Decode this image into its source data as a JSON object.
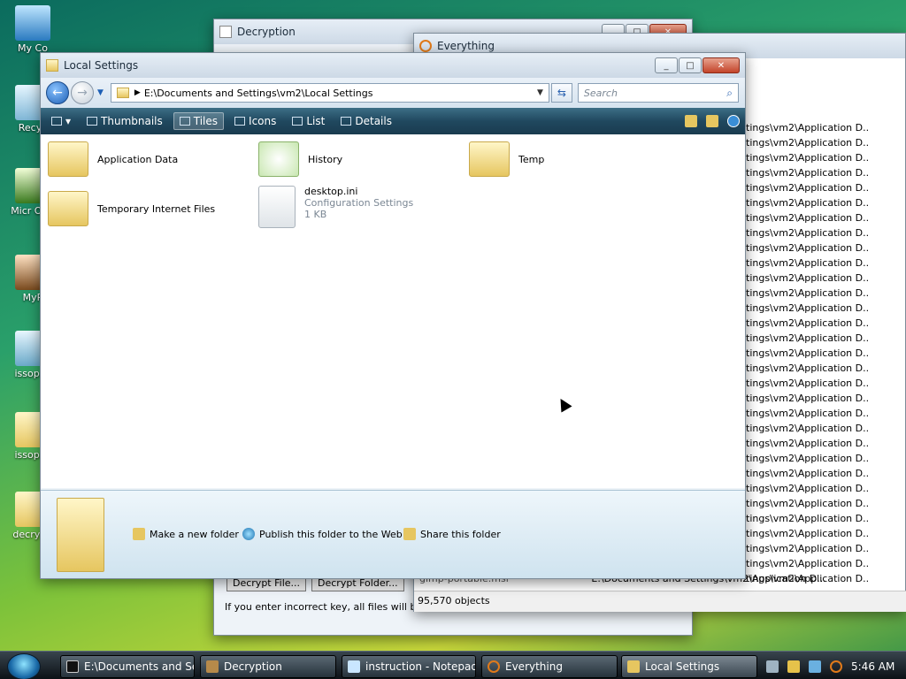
{
  "desktop": {
    "icons": [
      {
        "label": "My Co"
      },
      {
        "label": "Recyc"
      },
      {
        "label": "Micr Outl"
      },
      {
        "label": "MyP"
      },
      {
        "label": "issopac"
      },
      {
        "label": "issopac"
      },
      {
        "label": "decrypti"
      }
    ]
  },
  "decryption_window": {
    "title": "Decryption",
    "buttons": [
      "Decrypt File...",
      "Decrypt Folder..."
    ],
    "warning": "If you enter incorrect key, all files will be per"
  },
  "everything_window": {
    "title": "Everything",
    "path_fragment": "tings\\vm2\\Application D...",
    "partial_row": "gimp-portable.msi",
    "partial_path": "E:\\Documents and Settings\\vm2\\Application D...",
    "status": "95,570 objects"
  },
  "explorer": {
    "title": "Local Settings",
    "address": "E:\\Documents and Settings\\vm2\\Local Settings",
    "search_placeholder": "Search",
    "views": {
      "thumbnails": "Thumbnails",
      "tiles": "Tiles",
      "icons": "Icons",
      "list": "List",
      "details": "Details"
    },
    "items": [
      {
        "name": "Application Data",
        "type": "folder"
      },
      {
        "name": "History",
        "type": "history"
      },
      {
        "name": "Temp",
        "type": "folder"
      },
      {
        "name": "Temporary Internet Files",
        "type": "folder"
      },
      {
        "name": "desktop.ini",
        "sub1": "Configuration Settings",
        "sub2": "1 KB",
        "type": "file"
      }
    ],
    "tasks": {
      "new_folder": "Make a new folder",
      "publish": "Publish this folder to the Web",
      "share": "Share this folder"
    }
  },
  "taskbar": {
    "buttons": [
      {
        "label": "E:\\Documents and Se..."
      },
      {
        "label": "Decryption"
      },
      {
        "label": "instruction - Notepad"
      },
      {
        "label": "Everything"
      },
      {
        "label": "Local Settings"
      }
    ],
    "clock": "5:46 AM"
  },
  "colors": {
    "accent": "#1d5fb5",
    "folder": "#e6c660",
    "command_bar": "#20485f"
  }
}
